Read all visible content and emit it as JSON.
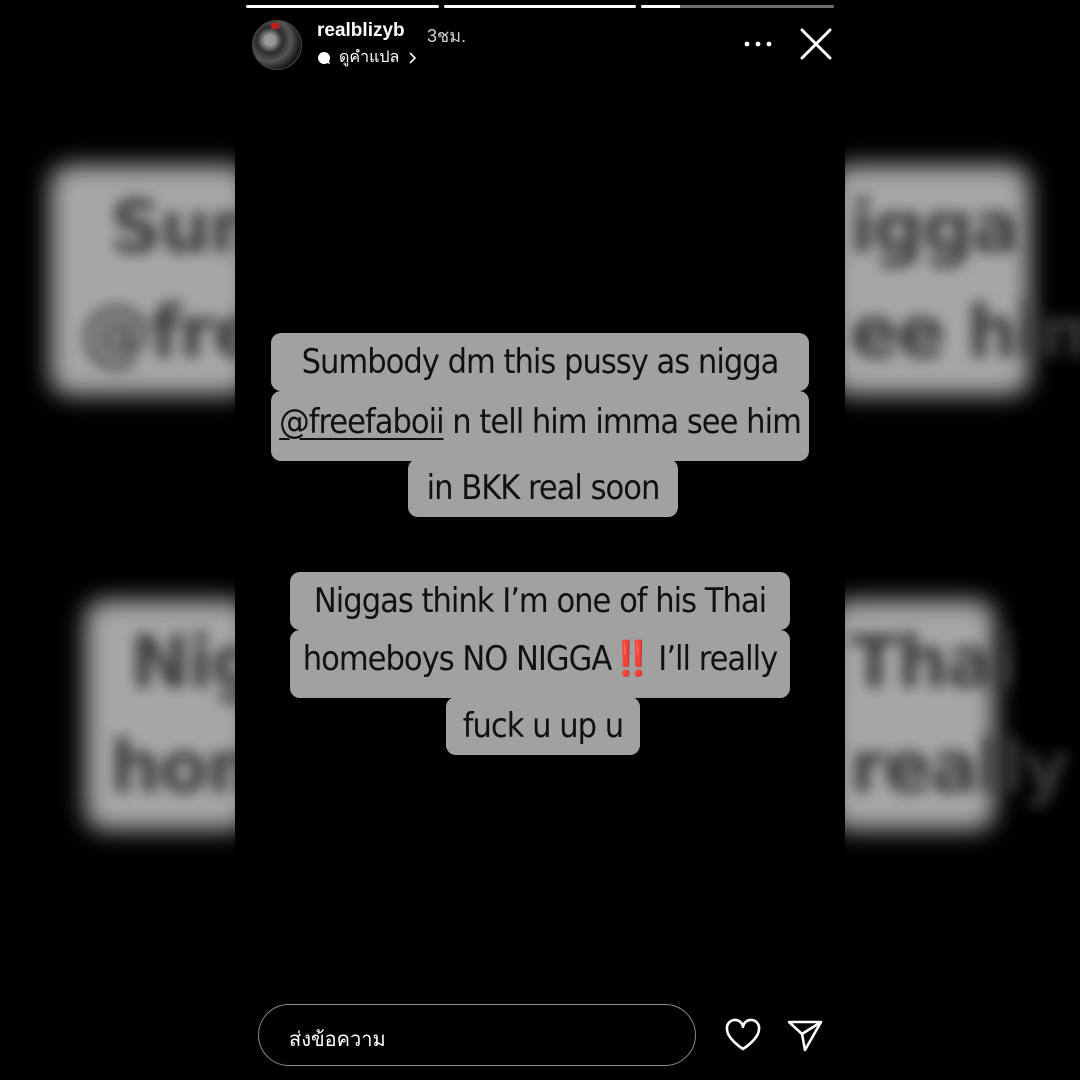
{
  "story": {
    "username": "realblizyb",
    "time_ago": "3ชม.",
    "translate_label": "ดูคำแปล",
    "progress": [
      1.0,
      1.0,
      0.2
    ]
  },
  "text_block_1": {
    "line1": "Sumbody dm this pussy as nigga",
    "mention": "@freefaboii",
    "line2_rest": " n tell him imma see him",
    "line3": "in BKK real soon"
  },
  "text_block_2": {
    "line1": "Niggas think I’m one of his Thai",
    "line2_pre": "homeboys NO NIGGA",
    "line2_emoji": "‼️",
    "line2_post": " I’ll really",
    "line3": "fuck u up u"
  },
  "reply": {
    "placeholder": "ส่งข้อความ"
  },
  "icons": {
    "more": "more-horizontal-icon",
    "close": "close-icon",
    "like": "heart-icon",
    "send": "send-icon"
  }
}
